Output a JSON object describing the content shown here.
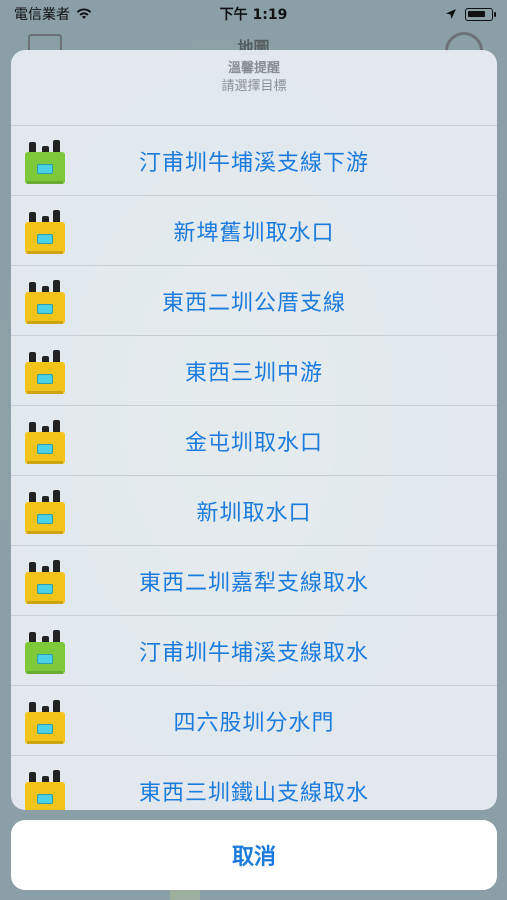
{
  "status_bar": {
    "carrier": "電信業者",
    "time": "下午 1:19"
  },
  "nav": {
    "title": "地圖"
  },
  "sheet": {
    "title": "溫馨提醒",
    "message": "請選擇目標",
    "options": [
      {
        "label": "汀甫圳牛埔溪支線下游",
        "status": "online",
        "color": "#7dc93a"
      },
      {
        "label": "新埤舊圳取水口",
        "status": "warning",
        "color": "#f2c419"
      },
      {
        "label": "東西二圳公厝支線",
        "status": "warning",
        "color": "#f2c419"
      },
      {
        "label": "東西三圳中游",
        "status": "warning",
        "color": "#f2c419"
      },
      {
        "label": "金屯圳取水口",
        "status": "warning",
        "color": "#f2c419"
      },
      {
        "label": "新圳取水口",
        "status": "warning",
        "color": "#f2c419"
      },
      {
        "label": "東西二圳嘉犁支線取水",
        "status": "warning",
        "color": "#f2c419"
      },
      {
        "label": "汀甫圳牛埔溪支線取水",
        "status": "online",
        "color": "#7dc93a"
      },
      {
        "label": "四六股圳分水門",
        "status": "warning",
        "color": "#f2c419"
      },
      {
        "label": "東西三圳鐵山支線取水",
        "status": "warning",
        "color": "#f2c419"
      }
    ]
  },
  "cancel_label": "取消",
  "colors": {
    "accent": "#1a7bdc",
    "device_online": "#7dc93a",
    "device_warning": "#f2c419"
  }
}
